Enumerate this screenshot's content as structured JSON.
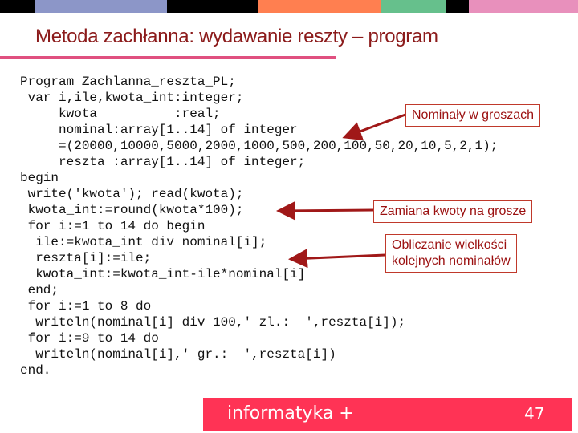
{
  "topbar": {
    "segments": [
      {
        "name": "black",
        "color": "#000000"
      },
      {
        "name": "lavender",
        "color": "#8c96c8"
      },
      {
        "name": "black",
        "color": "#000000"
      },
      {
        "name": "orange",
        "color": "#ff7f50"
      },
      {
        "name": "green",
        "color": "#66c08c"
      },
      {
        "name": "black",
        "color": "#000000"
      },
      {
        "name": "pink",
        "color": "#e890bc"
      }
    ]
  },
  "title": "Metoda zachłanna: wydawanie reszty – program",
  "code": {
    "lines": [
      "Program Zachlanna_reszta_PL;",
      " var i,ile,kwota_int:integer;",
      "     kwota          :real;",
      "     nominal:array[1..14] of integer",
      "     =(20000,10000,5000,2000,1000,500,200,100,50,20,10,5,2,1);",
      "     reszta :array[1..14] of integer;",
      "begin",
      " write('kwota'); read(kwota);",
      " kwota_int:=round(kwota*100);",
      " for i:=1 to 14 do begin",
      "  ile:=kwota_int div nominal[i];",
      "  reszta[i]:=ile;",
      "  kwota_int:=kwota_int-ile*nominal[i]",
      " end;",
      " for i:=1 to 8 do",
      "  writeln(nominal[i] div 100,' zl.:  ',reszta[i]);",
      " for i:=9 to 14 do",
      "  writeln(nominal[i],' gr.:  ',reszta[i])",
      "end."
    ]
  },
  "callouts": {
    "nominals": "Nominały w groszach",
    "conversion": "Zamiana kwoty na grosze",
    "counting_line1": "Obliczanie wielkości",
    "counting_line2": "kolejnych nominałów"
  },
  "footer": {
    "brand": "informatyka +",
    "page_number": "47"
  },
  "colors": {
    "title": "#8b1a1a",
    "underline": "#e05080",
    "footer_bg": "#ff3355",
    "callout_border": "#c0392b",
    "callout_text": "#9b1010",
    "arrow": "#a01818"
  }
}
